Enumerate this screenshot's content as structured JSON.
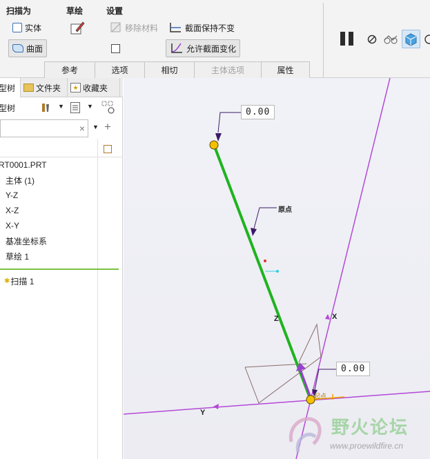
{
  "ribbon": {
    "group_sweep": "扫描为",
    "group_sketch": "草绘",
    "group_settings": "设置",
    "solid_label": "实体",
    "surface_label": "曲面",
    "remove_material_label": "移除材料",
    "constant_section_label": "截面保持不变",
    "variable_section_label": "允许截面变化",
    "tabs": [
      "参考",
      "选项",
      "相切",
      "主体选项",
      "属性"
    ]
  },
  "panel": {
    "tabs": [
      "型树",
      "文件夹",
      "收藏夹"
    ],
    "toolbar_title": "型树",
    "search_placeholder": "",
    "tree": [
      "RT0001.PRT",
      "主体 (1)",
      "Y-Z",
      "X-Z",
      "X-Y",
      "基准坐标系",
      "草绘 1"
    ],
    "feature": "扫描 1"
  },
  "viewport": {
    "dim_top": "0.00",
    "dim_bottom": "0.00",
    "label_origin": "原点",
    "label_start": "起点",
    "axis_x": "X",
    "axis_y": "Y",
    "axis_z": "Z"
  },
  "watermark": {
    "title": "野火论坛",
    "url": "www.proewildfire.cn"
  },
  "colors": {
    "trajectory": "#1fb31f",
    "axis": "#b348d8",
    "handle": "#f5c000",
    "arrow": "#9a40d0"
  }
}
